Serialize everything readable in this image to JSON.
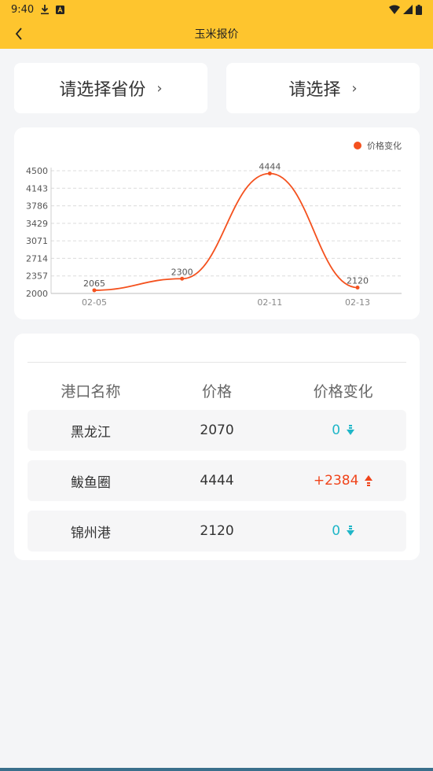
{
  "status_bar": {
    "time": "9:40"
  },
  "nav": {
    "title": "玉米报价"
  },
  "selectors": {
    "province_label": "请选择省份",
    "second_label": "请选择",
    "chevron": "›"
  },
  "chart_data": {
    "type": "line",
    "legend": [
      "价格变化"
    ],
    "x": [
      "02-05",
      "",
      "02-11",
      "02-13"
    ],
    "x_tick_labels": [
      "02-05",
      "02-11",
      "02-13"
    ],
    "series": [
      {
        "name": "价格变化",
        "values": [
          2065,
          2300,
          4444,
          2120
        ]
      }
    ],
    "data_labels": [
      "2065",
      "2300",
      "4444",
      "2120"
    ],
    "y_ticks": [
      "4500",
      "4143",
      "3786",
      "3429",
      "3071",
      "2714",
      "2357",
      "2000"
    ],
    "ylim": [
      2000,
      4500
    ],
    "grid": true,
    "legend_position": "top-right",
    "color": "#f4511e"
  },
  "table": {
    "headers": [
      "港口名称",
      "价格",
      "价格变化"
    ],
    "rows": [
      {
        "name": "黑龙江",
        "price": "2070",
        "change": "0",
        "direction": "down"
      },
      {
        "name": "鲅鱼圈",
        "price": "4444",
        "change": "+2384",
        "direction": "up"
      },
      {
        "name": "锦州港",
        "price": "2120",
        "change": "0",
        "direction": "down"
      }
    ]
  },
  "colors": {
    "header": "#fec52e",
    "accent": "#f4511e",
    "teal": "#1fb6c8"
  }
}
